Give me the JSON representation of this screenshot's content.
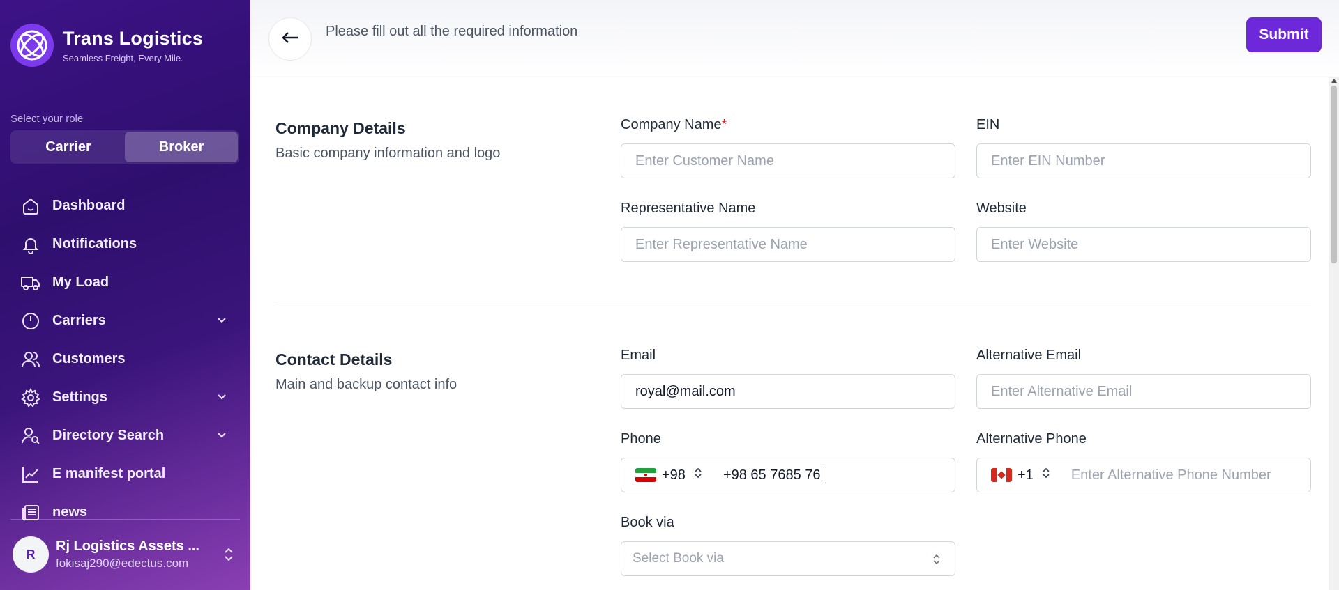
{
  "brand": {
    "title": "Trans Logistics",
    "subtitle": "Seamless Freight, Every Mile."
  },
  "role": {
    "label": "Select your role",
    "options": [
      "Carrier",
      "Broker"
    ],
    "selected": "Broker"
  },
  "nav": [
    {
      "label": "Dashboard",
      "icon": "home-icon"
    },
    {
      "label": "Notifications",
      "icon": "bell-icon"
    },
    {
      "label": "My Load",
      "icon": "truck-icon"
    },
    {
      "label": "Carriers",
      "icon": "gauge-icon",
      "expandable": true
    },
    {
      "label": "Customers",
      "icon": "users-icon"
    },
    {
      "label": "Settings",
      "icon": "gear-icon",
      "expandable": true
    },
    {
      "label": "Directory Search",
      "icon": "user-search-icon",
      "expandable": true
    },
    {
      "label": "E manifest portal",
      "icon": "chart-line-icon"
    },
    {
      "label": "news",
      "icon": "newspaper-icon"
    }
  ],
  "user": {
    "initial": "R",
    "name": "Rj Logistics Assets ...",
    "email": "fokisaj290@edectus.com"
  },
  "header": {
    "message": "Please fill out all the required information",
    "submit_label": "Submit"
  },
  "company": {
    "title": "Company Details",
    "subtitle": "Basic company information and logo",
    "company_name_label": "Company Name",
    "company_name_required": "*",
    "company_name_placeholder": "Enter Customer Name",
    "ein_label": "EIN",
    "ein_placeholder": "Enter EIN Number",
    "rep_label": "Representative Name",
    "rep_placeholder": "Enter Representative Name",
    "website_label": "Website",
    "website_placeholder": "Enter Website"
  },
  "contact": {
    "title": "Contact Details",
    "subtitle": "Main and backup contact info",
    "email_label": "Email",
    "email_value": "royal@mail.com",
    "alt_email_label": "Alternative Email",
    "alt_email_placeholder": "Enter Alternative Email",
    "phone_label": "Phone",
    "phone_code": "+98",
    "phone_value": "+98 65 7685 76",
    "alt_phone_label": "Alternative Phone",
    "alt_phone_code": "+1",
    "alt_phone_placeholder": "Enter Alternative Phone Number",
    "book_via_label": "Book via",
    "book_via_placeholder": "Select Book via"
  },
  "colors": {
    "accent": "#6d28d9",
    "sidebar": "#3d1286",
    "required": "#dc2626"
  }
}
